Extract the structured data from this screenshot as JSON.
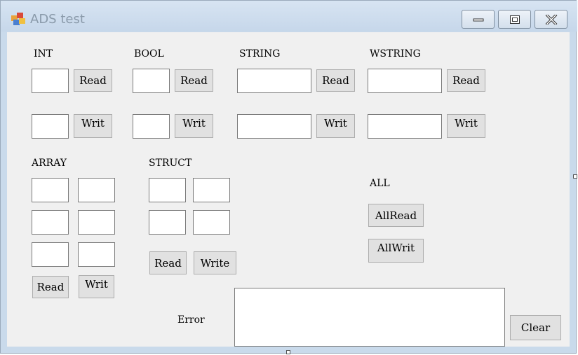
{
  "window": {
    "title": "ADS test",
    "controls": {
      "minimize_icon": "minimize-icon",
      "maximize_icon": "maximize-icon",
      "close_icon": "close-icon"
    },
    "colors": {
      "titlebar": "#c9daeb",
      "client": "#f0f0f0",
      "button": "#e1e1e1",
      "title_text": "#8a9aaa"
    }
  },
  "int_group": {
    "label": "INT",
    "read_value": "",
    "write_value": "",
    "read_button": "Read",
    "write_button": "Writ"
  },
  "bool_group": {
    "label": "BOOL",
    "read_value": "",
    "write_value": "",
    "read_button": "Read",
    "write_button": "Writ"
  },
  "string_group": {
    "label": "STRING",
    "read_value": "",
    "write_value": "",
    "read_button": "Read",
    "write_button": "Writ"
  },
  "wstring_group": {
    "label": "WSTRING",
    "read_value": "",
    "write_value": "",
    "read_button": "Read",
    "write_button": "Writ"
  },
  "array_group": {
    "label": "ARRAY",
    "values": [
      "",
      "",
      "",
      "",
      "",
      ""
    ],
    "read_button": "Read",
    "write_button": "Writ"
  },
  "struct_group": {
    "label": "STRUCT",
    "values": [
      "",
      "",
      "",
      ""
    ],
    "read_button": "Read",
    "write_button": "Write"
  },
  "all_group": {
    "label": "ALL",
    "read_button": "AllRead",
    "write_button": "AllWrit"
  },
  "error_group": {
    "label": "Error",
    "value": "",
    "clear_button": "Clear"
  }
}
